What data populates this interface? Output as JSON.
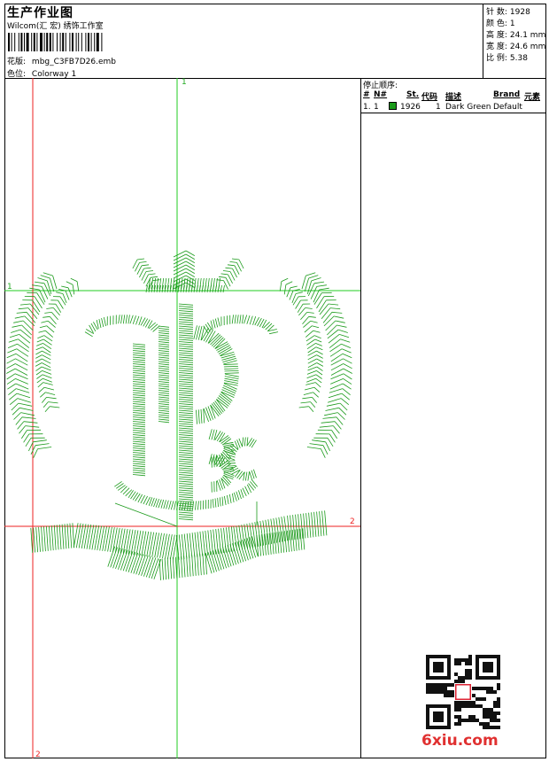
{
  "header": {
    "title": "生产作业图",
    "subtitle": "Wilcom(汇 宏) 绣饰工作室",
    "design_label": "花版:",
    "design_value": "mbg_C3FB7D26.emb",
    "colorway_label": "色位:",
    "colorway_value": "Colorway 1"
  },
  "stats": [
    {
      "label": "针 数:",
      "value": "1928"
    },
    {
      "label": "颜 色:",
      "value": "1"
    },
    {
      "label": "高 度:",
      "value": "24.1 mm"
    },
    {
      "label": "宽 度:",
      "value": "24.6 mm"
    },
    {
      "label": "比 例:",
      "value": "5.38"
    }
  ],
  "stop_sequence": {
    "heading": "停止顺序:",
    "columns": [
      "#",
      "N#",
      "St.",
      "代码",
      "描述",
      "Brand",
      "元素"
    ],
    "rows": [
      {
        "index": "1.",
        "n": "1",
        "swatch_color": "#1a9a1a",
        "stitches": "1926",
        "code": "1",
        "description": "Dark Green",
        "brand": "Default",
        "element": ""
      }
    ]
  },
  "canvas": {
    "axis_labels": {
      "top": "1",
      "left": "1",
      "right": "2",
      "bottom": "2"
    },
    "guide_green": "#22cc22",
    "guide_red": "#ee2222",
    "stitch_color": "#1a9a1a"
  },
  "watermark": {
    "text": "6xiu.com"
  }
}
